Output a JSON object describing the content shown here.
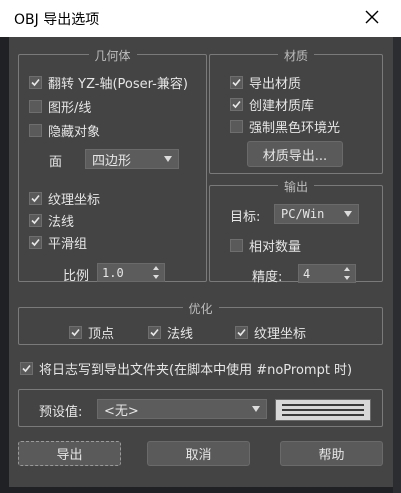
{
  "window": {
    "title": "OBJ 导出选项",
    "close_icon": "close-icon"
  },
  "geometry": {
    "title": "几何体",
    "flip_yz": {
      "label": "翻转 YZ-轴(Poser-兼容)",
      "checked": true
    },
    "shapes_lines": {
      "label": "图形/线",
      "checked": false
    },
    "hidden_objects": {
      "label": "隐藏对象",
      "checked": false
    },
    "faces_label": "面",
    "faces_value": "四边形",
    "texture_coords": {
      "label": "纹理坐标",
      "checked": true
    },
    "normals": {
      "label": "法线",
      "checked": true
    },
    "smoothing_groups": {
      "label": "平滑组",
      "checked": true
    },
    "scale_label": "比例",
    "scale_value": "1.0"
  },
  "material": {
    "title": "材质",
    "export_materials": {
      "label": "导出材质",
      "checked": true
    },
    "create_library": {
      "label": "创建材质库",
      "checked": true
    },
    "force_black_ambient": {
      "label": "强制黑色环境光",
      "checked": false
    },
    "export_button": "材质导出..."
  },
  "output": {
    "title": "输出",
    "target_label": "目标:",
    "target_value": "PC/Win",
    "relative_numbers": {
      "label": "相对数量",
      "checked": false
    },
    "precision_label": "精度:",
    "precision_value": "4"
  },
  "optimize": {
    "title": "优化",
    "vertices": {
      "label": "顶点",
      "checked": true
    },
    "normals": {
      "label": "法线",
      "checked": true
    },
    "texture_coords": {
      "label": "纹理坐标",
      "checked": true
    }
  },
  "log": {
    "label": "将日志写到导出文件夹(在脚本中使用 #noPrompt 时)",
    "checked": true
  },
  "preset": {
    "label": "预设值:",
    "value": "<无>"
  },
  "buttons": {
    "export": "导出",
    "cancel": "取消",
    "help": "帮助"
  },
  "colors": {
    "dialog_bg": "#444444",
    "titlebar_bg": "#ffffff",
    "control_bg": "#5c5c5c"
  }
}
